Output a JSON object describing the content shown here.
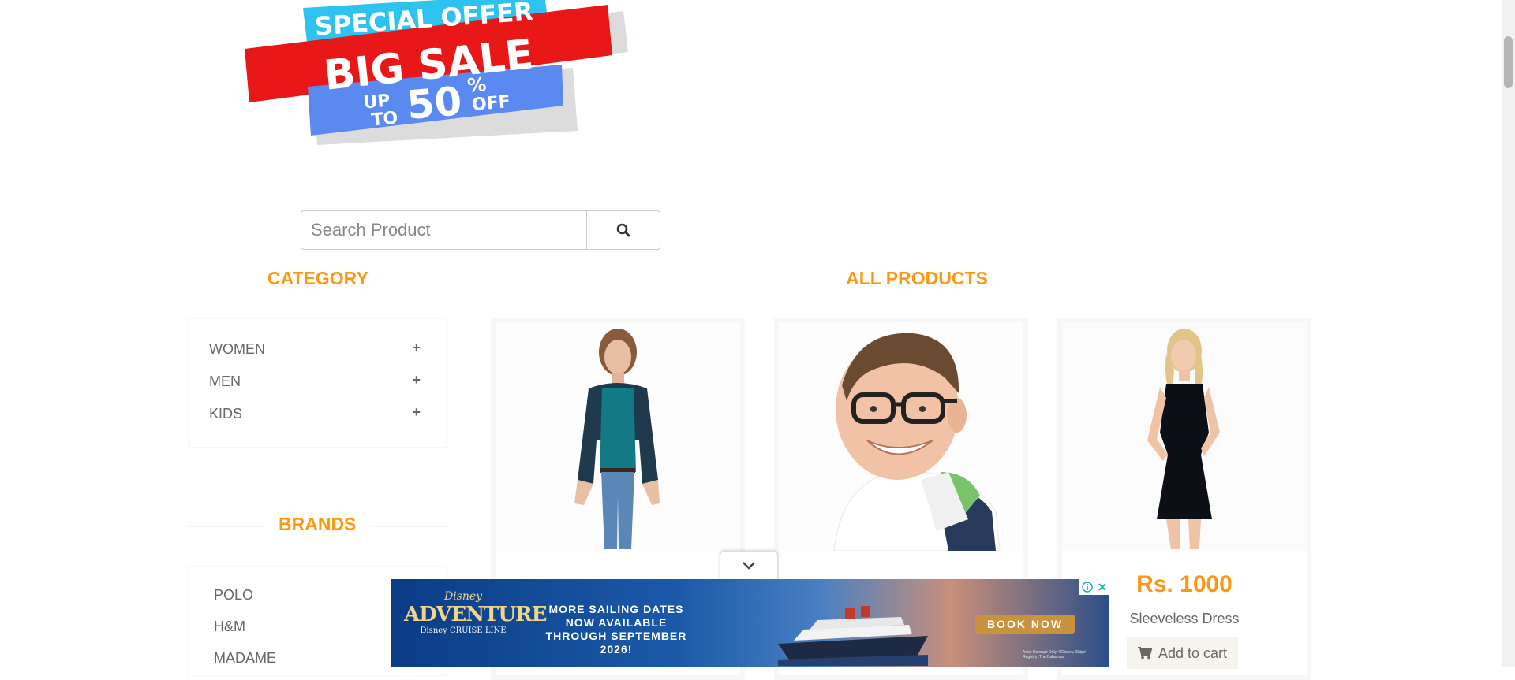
{
  "banner": {
    "line1": "SPECIAL OFFER",
    "line2": "BIG SALE",
    "up": "UP",
    "to": "TO",
    "percent_value": "50",
    "percent_sign": "%",
    "off": "OFF"
  },
  "search": {
    "placeholder": "Search Product",
    "value": ""
  },
  "category": {
    "title": "CATEGORY",
    "items": [
      {
        "label": "WOMEN"
      },
      {
        "label": "MEN"
      },
      {
        "label": "KIDS"
      }
    ],
    "plus": "+"
  },
  "brands": {
    "title": "BRANDS",
    "items": [
      {
        "label": "POLO"
      },
      {
        "label": "H&M"
      },
      {
        "label": "MADAME"
      }
    ]
  },
  "products": {
    "title": "ALL PRODUCTS",
    "items": [
      {
        "price": "",
        "name": ""
      },
      {
        "price": "",
        "name": ""
      },
      {
        "price": "Rs. 1000",
        "name": "Sleeveless Dress",
        "cart_label": "Add to cart"
      }
    ]
  },
  "ad": {
    "brand_top": "Disney",
    "brand_main": "ADVENTURE",
    "brand_sub": "Disney CRUISE LINE",
    "headline": "MORE SAILING DATES NOW AVAILABLE THROUGH SEPTEMBER 2026!",
    "cta": "BOOK NOW",
    "fine_print": "Artist Concept Only. ©Disney. Ships' Registry: The Bahamas."
  },
  "colors": {
    "accent": "#FE980F",
    "text": "#696763",
    "cart_bg": "#F5F5ED"
  },
  "icons": {
    "search": "search-icon",
    "cart": "cart-icon",
    "chevron": "chevron-down-icon",
    "info": "info-icon",
    "close": "close-icon"
  }
}
